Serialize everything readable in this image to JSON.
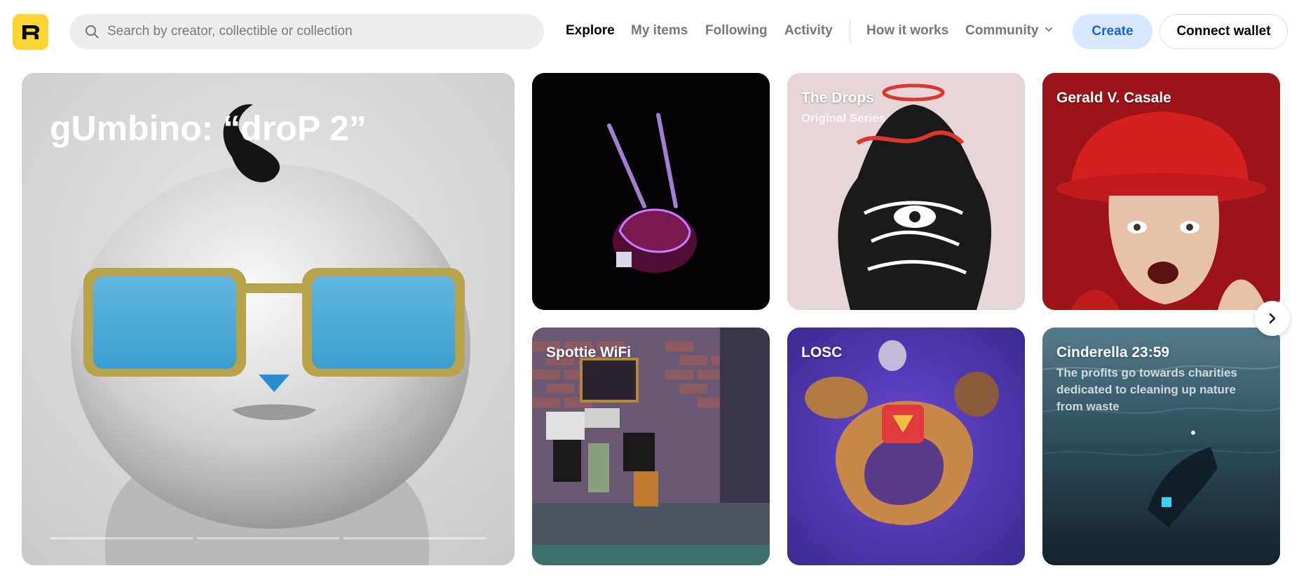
{
  "header": {
    "logo_letter": "R",
    "search": {
      "placeholder": "Search by creator, collectible or collection",
      "value": ""
    },
    "nav": [
      {
        "label": "Explore",
        "active": true
      },
      {
        "label": "My items",
        "active": false
      },
      {
        "label": "Following",
        "active": false
      },
      {
        "label": "Activity",
        "active": false
      },
      {
        "label": "How it works",
        "active": false
      },
      {
        "label": "Community",
        "active": false
      }
    ],
    "create_label": "Create",
    "connect_label": "Connect wallet"
  },
  "hero": {
    "title": "gUmbino: “droP 2”",
    "slides_total": 3,
    "current_slide": 1,
    "current_progress": 0.0
  },
  "cards": [
    {
      "title": "",
      "subtitle": ""
    },
    {
      "title": "The Drops",
      "subtitle": "Original Series"
    },
    {
      "title": "Gerald V. Casale",
      "subtitle": ""
    },
    {
      "title": "Spottie WiFi",
      "subtitle": ""
    },
    {
      "title": "LOSC",
      "subtitle": ""
    },
    {
      "title": "Cinderella 23:59",
      "subtitle": "The profits go towards charities\ndedicated to cleaning up nature\nfrom waste"
    }
  ],
  "colors": {
    "brand_yellow": "#fcd535",
    "create_bg": "#d9e9fd",
    "create_text": "#1464d8"
  },
  "icons": {
    "search": "magnifier-icon",
    "community_dropdown": "chevron-down-icon",
    "carousel_next": "chevron-right-icon"
  }
}
